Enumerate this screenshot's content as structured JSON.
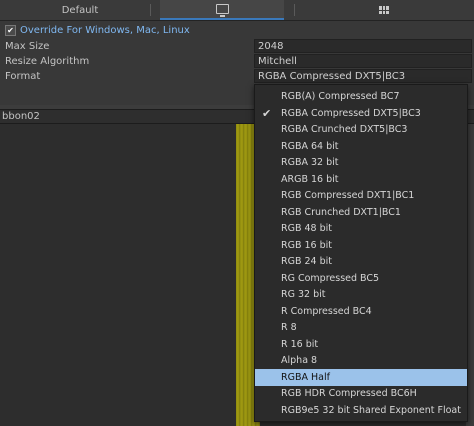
{
  "tabs": {
    "default_label": "Default",
    "pc_icon": "monitor-icon",
    "other_icon": "grid-icon"
  },
  "settings": {
    "override_checked": true,
    "override_label": "Override For Windows, Mac, Linux",
    "max_size_label": "Max Size",
    "max_size_value": "2048",
    "resize_label": "Resize Algorithm",
    "resize_value": "Mitchell",
    "format_label": "Format",
    "format_value": "RGBA Compressed DXT5|BC3"
  },
  "asset": {
    "name": "bbon02"
  },
  "colors": {
    "accent": "#3a79bb",
    "highlight": "#9bc2ea",
    "override_label": "#7fb7f0"
  },
  "format_menu": {
    "items": [
      {
        "label": "RGB(A) Compressed BC7",
        "checked": false,
        "highlighted": false
      },
      {
        "label": "RGBA Compressed DXT5|BC3",
        "checked": true,
        "highlighted": false
      },
      {
        "label": "RGBA Crunched DXT5|BC3",
        "checked": false,
        "highlighted": false
      },
      {
        "label": "RGBA 64 bit",
        "checked": false,
        "highlighted": false
      },
      {
        "label": "RGBA 32 bit",
        "checked": false,
        "highlighted": false
      },
      {
        "label": "ARGB 16 bit",
        "checked": false,
        "highlighted": false
      },
      {
        "label": "RGB Compressed DXT1|BC1",
        "checked": false,
        "highlighted": false
      },
      {
        "label": "RGB Crunched DXT1|BC1",
        "checked": false,
        "highlighted": false
      },
      {
        "label": "RGB 48 bit",
        "checked": false,
        "highlighted": false
      },
      {
        "label": "RGB 16 bit",
        "checked": false,
        "highlighted": false
      },
      {
        "label": "RGB 24 bit",
        "checked": false,
        "highlighted": false
      },
      {
        "label": "RG Compressed BC5",
        "checked": false,
        "highlighted": false
      },
      {
        "label": "RG 32 bit",
        "checked": false,
        "highlighted": false
      },
      {
        "label": "R Compressed BC4",
        "checked": false,
        "highlighted": false
      },
      {
        "label": "R 8",
        "checked": false,
        "highlighted": false
      },
      {
        "label": "R 16 bit",
        "checked": false,
        "highlighted": false
      },
      {
        "label": "Alpha 8",
        "checked": false,
        "highlighted": false
      },
      {
        "label": "RGBA Half",
        "checked": false,
        "highlighted": true
      },
      {
        "label": "RGB HDR Compressed BC6H",
        "checked": false,
        "highlighted": false
      },
      {
        "label": "RGB9e5 32 bit Shared Exponent Float",
        "checked": false,
        "highlighted": false
      }
    ]
  }
}
